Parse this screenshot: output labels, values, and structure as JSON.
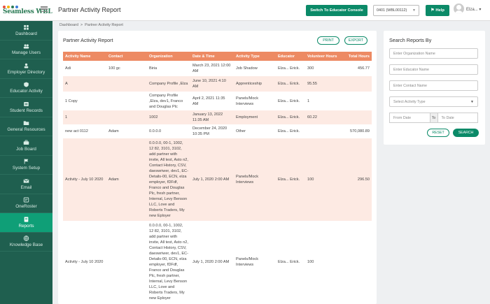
{
  "logo": {
    "line1": "Seamless",
    "line2": "WBL"
  },
  "sidebar": {
    "items": [
      {
        "label": "Dashboard",
        "icon": "dashboard-icon"
      },
      {
        "label": "Manage Users",
        "icon": "users-icon"
      },
      {
        "label": "Employer Directory",
        "icon": "user-icon"
      },
      {
        "label": "Educator Activity",
        "icon": "shield-icon"
      },
      {
        "label": "Student Records",
        "icon": "records-icon"
      },
      {
        "label": "General Resources",
        "icon": "folder-icon"
      },
      {
        "label": "Job Board",
        "icon": "briefcase-icon"
      },
      {
        "label": "System Setup",
        "icon": "flag-icon"
      },
      {
        "label": "Email",
        "icon": "email-icon"
      },
      {
        "label": "OneRoster",
        "icon": "roster-icon"
      },
      {
        "label": "Reports",
        "icon": "reports-icon"
      },
      {
        "label": "Knowledge Base",
        "icon": "globe-icon"
      }
    ]
  },
  "header": {
    "title": "Partner Activity Report",
    "console_label": "Switch To Educator Console",
    "account_value": "0401 (WBL00112)",
    "help_label": "Help",
    "user_name": "Elza..."
  },
  "breadcrumb": {
    "home": "Dashboard",
    "separator": ">",
    "current": "Partner Activity Report"
  },
  "report": {
    "title": "Partner Activity Report",
    "print_label": "PRINT",
    "export_label": "EXPORT",
    "columns": [
      "Activity Name",
      "Contact",
      "Organization",
      "Date & Time",
      "Activity Type",
      "Educator",
      "Volunteer Hours",
      "Total Hours"
    ],
    "rows": [
      [
        "Adi",
        "100 gc",
        "Biria",
        "March 23, 2021 12:00 AM",
        "Job Shadow",
        "Elza...  Erick.",
        "300",
        "456.77"
      ],
      [
        "A",
        "",
        "Company Profile ,Elza",
        "June 10, 2021 4:10 AM",
        "Apprenticeship",
        "Elza...  Erick.",
        "95.55",
        ""
      ],
      [
        "1 Copy",
        "",
        "Company Profile ,Elza, dev1, Franco and Douglas Plc",
        "April 2, 2021 11:35 AM",
        "Panels/Mock Interviews",
        "Elza...  Erick.",
        "1",
        ""
      ],
      [
        "1",
        "",
        "1002",
        "January 13, 2022 11:35 AM",
        "Employment",
        "Elza...  Erick.",
        "60.22",
        ""
      ],
      [
        "new act 0112",
        "Adam",
        "0.0.0.0",
        "December 24, 2020 10:35 PM",
        "Other",
        "Elza...  Erick.",
        "",
        "570,080.89"
      ],
      [
        "Activity - July 10 2020",
        "Adam",
        "0.0.0.0, 00-1, 1002, 12 82, 3101, 3102, add partner with invite, All test, Asto n2, Contact History, CSV, daeswriwer, dev1, EC-Details-00, ECN, elza employer, fDFdf, Franco and Douglas Plc, fresh partner, Internal, Levy Benson LLC, Love and Roberts Traders, My new Eployer",
        "July 1, 2020 2:00 AM",
        "Panels/Mock Interviews",
        "Elza...  Erick.",
        "100",
        "296.50"
      ],
      [
        "Activity - July 10 2020",
        "",
        "0.0.0.0, 00-1, 1002, 12 82, 3101, 3102, add partner with invite, All test, Asto n2, Contact History, CSV, daeswriwer, dev1, EC-Details-00, ECN, elza employer, fDFdf, Franco and Douglas Plc, fresh partner, Internal, Levy Benson LLC, Love and Roberts Traders, My new Eployer",
        "July 1, 2020 2:00 AM",
        "Panels/Mock Interviews",
        "Elza...  Erick.",
        "100",
        ""
      ]
    ]
  },
  "search": {
    "title": "Search Reports By",
    "org_placeholder": "Enter Organization Name",
    "educator_placeholder": "Enter Educator Name",
    "contact_placeholder": "Enter Contact Name",
    "activity_type_value": "Select Activity Type",
    "from_placeholder": "From Date",
    "to_label": "To",
    "to_placeholder": "To Date",
    "reset_label": "RESET",
    "search_label": "SEARCH"
  },
  "colors": {
    "sidebar": "#1f5f4f",
    "active": "#0f9f77",
    "accent": "#0b8a68",
    "table_header": "#ed8a63",
    "row_alt": "#fdeae3"
  }
}
